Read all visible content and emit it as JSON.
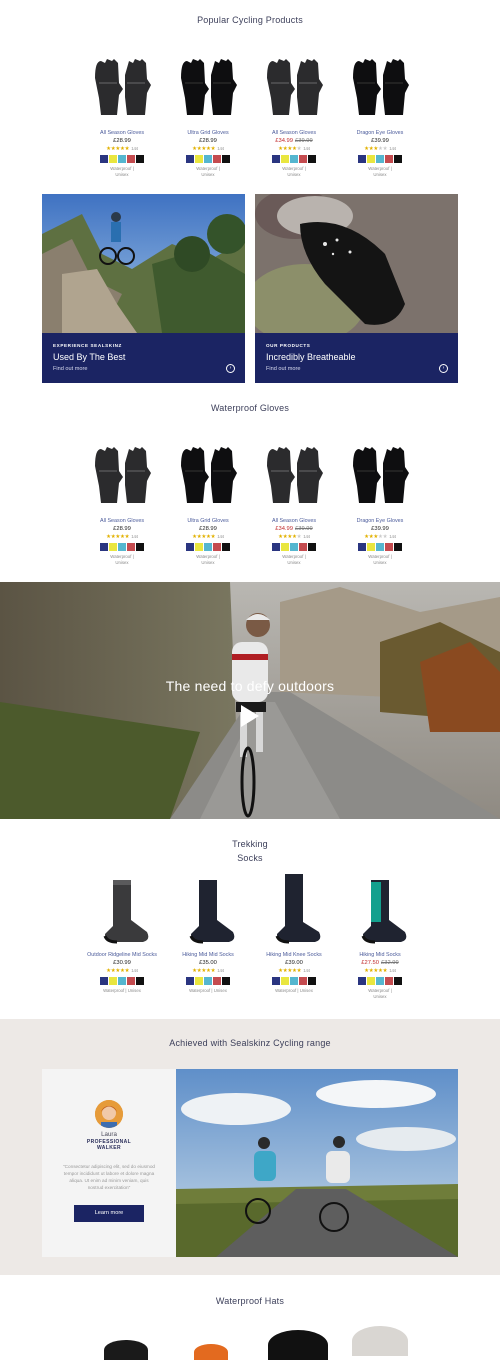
{
  "colors": {
    "navy": "#1b2463",
    "sale": "#c0282a",
    "star": "#e2b100",
    "swatches": [
      "#2a3580",
      "#e9e63f",
      "#55b6cf",
      "#c44b4f",
      "#111111"
    ]
  },
  "sections": {
    "popular": "Popular Cycling Products",
    "waterproof_gloves": "Waterproof Gloves",
    "trekking_line1": "Trekking",
    "trekking_line2": "Socks",
    "achieved": "Achieved with Sealskinz Cycling range",
    "hats": "Waterproof Hats"
  },
  "popular_products": [
    {
      "name": "All Season Gloves",
      "price": "£28.99",
      "was": "",
      "stars": 5,
      "count": "144",
      "meta1": "Waterproof |",
      "meta2": "Unisex",
      "icon": "glove-icon-grey"
    },
    {
      "name": "Ultra Grid Gloves",
      "price": "£28.99",
      "was": "",
      "stars": 5,
      "count": "144",
      "meta1": "Waterproof |",
      "meta2": "Unisex",
      "icon": "glove-icon-black"
    },
    {
      "name": "All Season Gloves",
      "price": "£34.99",
      "was": "£39.99",
      "stars": 4,
      "count": "144",
      "meta1": "Waterproof |",
      "meta2": "Unisex",
      "icon": "glove-icon-grey"
    },
    {
      "name": "Dragon Eye Gloves",
      "price": "£39.99",
      "was": "",
      "stars": 3,
      "count": "144",
      "meta1": "Waterproof |",
      "meta2": "Unisex",
      "icon": "glove-icon-black"
    }
  ],
  "promos": [
    {
      "kicker": "EXPERIENCE SEALSKINZ",
      "head": "Used By The Best",
      "link": "Find out more"
    },
    {
      "kicker": "OUR PRODUCTS",
      "head": "Incredibly Breatheable",
      "link": "Find out more"
    }
  ],
  "glove_products": [
    {
      "name": "All Season Gloves",
      "price": "£28.99",
      "was": "",
      "stars": 5,
      "count": "144",
      "meta1": "Waterproof |",
      "meta2": "Unisex"
    },
    {
      "name": "Ultra Grid Gloves",
      "price": "£28.99",
      "was": "",
      "stars": 5,
      "count": "144",
      "meta1": "Waterproof |",
      "meta2": "Unisex"
    },
    {
      "name": "All Season Gloves",
      "price": "£34.99",
      "was": "£39.99",
      "stars": 4,
      "count": "144",
      "meta1": "Waterproof |",
      "meta2": "Unisex"
    },
    {
      "name": "Dragon Eye Gloves",
      "price": "£39.99",
      "was": "",
      "stars": 3,
      "count": "144",
      "meta1": "Waterproof |",
      "meta2": "Unisex"
    }
  ],
  "video": {
    "caption": "The need to defy outdoors"
  },
  "sock_products": [
    {
      "name": "Outdoor Ridgeline Mid Socks",
      "price": "£30.99",
      "was": "",
      "stars": 5,
      "count": "144",
      "meta1": "Waterproof | Unisex",
      "meta2": ""
    },
    {
      "name": "Hiking Mid Mid Socks",
      "price": "£35.00",
      "was": "",
      "stars": 5,
      "count": "144",
      "meta1": "Waterproof | Unisex",
      "meta2": ""
    },
    {
      "name": "Hiking Mid Knee Socks",
      "price": "£39.00",
      "was": "",
      "stars": 5,
      "count": "144",
      "meta1": "Waterproof | Unisex",
      "meta2": ""
    },
    {
      "name": "Hiking Mid Socks",
      "price": "£27.50",
      "was": "£32.99",
      "stars": 5,
      "count": "144",
      "meta1": "Waterproof |",
      "meta2": "Unisex"
    }
  ],
  "testimonial": {
    "name": "Laura",
    "role1": "PROFESSIONAL",
    "role2": "WALKER",
    "quote": "\"Consectetur adipiscing elit, sed do eiusmod tempor incididunt ut labore et dolore magna aliqua. Ut enim ad minim veniam, quis nostrud exercitation\"",
    "button": "Learn more"
  }
}
